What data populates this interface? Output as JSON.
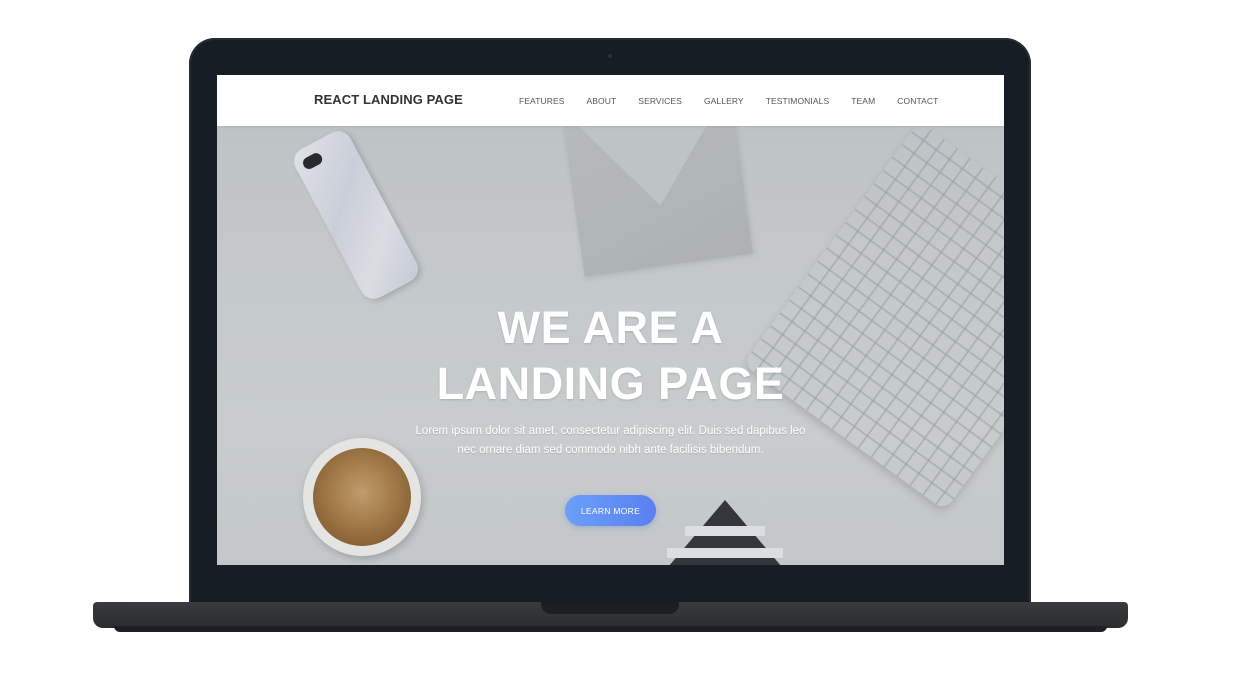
{
  "navbar": {
    "brand": "REACT LANDING PAGE",
    "links": [
      {
        "label": "FEATURES"
      },
      {
        "label": "ABOUT"
      },
      {
        "label": "SERVICES"
      },
      {
        "label": "GALLERY"
      },
      {
        "label": "TESTIMONIALS"
      },
      {
        "label": "TEAM"
      },
      {
        "label": "CONTACT"
      }
    ]
  },
  "hero": {
    "title_line1": "WE ARE A",
    "title_line2": "LANDING PAGE",
    "paragraph": "Lorem ipsum dolor sit amet, consectetur adipiscing elit. Duis sed dapibus leo nec ornare diam sed commodo nibh ante facilisis bibendum.",
    "button_label": "LEARN MORE"
  },
  "colors": {
    "button_gradient_start": "#6a9ff8",
    "button_gradient_end": "#5b80f0",
    "laptop_bezel": "#161d24",
    "navbar_bg": "#ffffff",
    "brand_text": "#333333"
  }
}
